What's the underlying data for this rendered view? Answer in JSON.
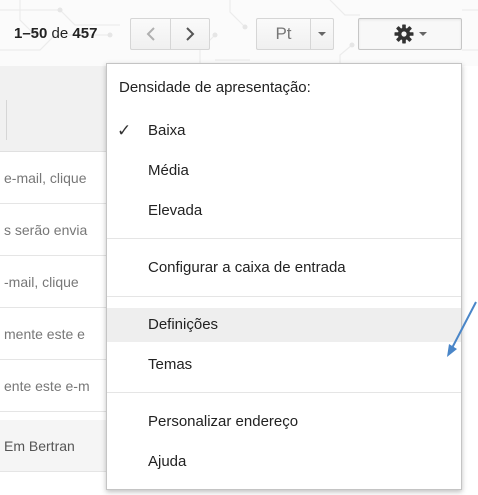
{
  "header": {
    "page_range": "1–50",
    "page_of": "de",
    "page_total": "457",
    "prev_icon": "chevron-left-icon",
    "next_icon": "chevron-right-icon",
    "language_label": "Pt",
    "settings_icon": "gear-icon"
  },
  "email_rows": [
    "e-mail, clique",
    "s serão envia",
    "-mail, clique",
    "mente este e",
    "ente este e-m",
    "Em Bertran"
  ],
  "menu": {
    "heading": "Densidade de apresentação:",
    "density_options": [
      {
        "label": "Baixa",
        "checked": true
      },
      {
        "label": "Média",
        "checked": false
      },
      {
        "label": "Elevada",
        "checked": false
      }
    ],
    "configure_inbox": "Configurar a caixa de entrada",
    "settings": "Definições",
    "themes": "Temas",
    "custom_address": "Personalizar endereço",
    "help": "Ajuda"
  },
  "colors": {
    "annotation_arrow": "#4a86c8",
    "hover_bg": "#eeeeee"
  }
}
